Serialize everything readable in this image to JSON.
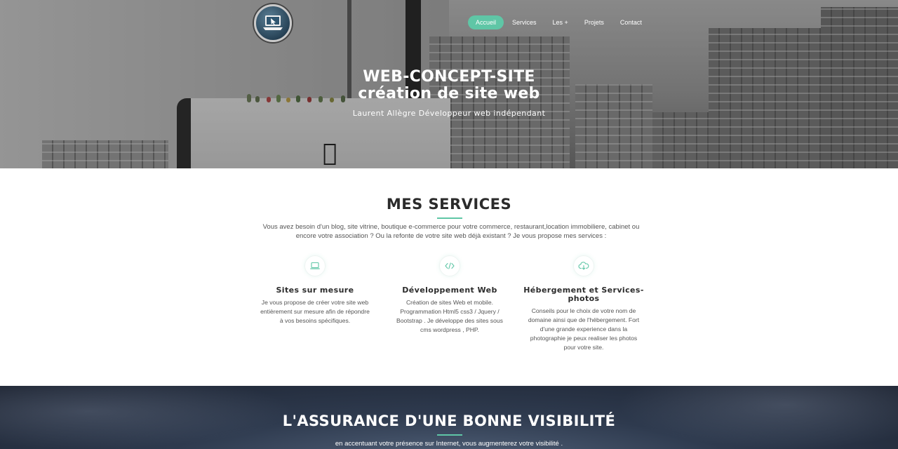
{
  "brand": {
    "logo_icon": "laptop-cursor-icon",
    "accent": "#5fc6a6"
  },
  "nav": {
    "items": [
      {
        "label": "Accueil",
        "active": true
      },
      {
        "label": "Services",
        "active": false
      },
      {
        "label": "Les +",
        "active": false
      },
      {
        "label": "Projets",
        "active": false
      },
      {
        "label": "Contact",
        "active": false
      }
    ]
  },
  "hero": {
    "title_line1": "WEB-CONCEPT-SITE",
    "title_line2": "création de site web",
    "subtitle": "Laurent Allègre Développeur web indépendant"
  },
  "services": {
    "title": "MES SERVICES",
    "intro": "Vous avez besoin d'un blog, site vitrine, boutique e-commerce pour votre commerce, restaurant,location immobiliere, cabinet ou encore votre association ? Ou la refonte de votre site web déjà existant ? Je vous propose mes services :",
    "items": [
      {
        "icon": "laptop-icon",
        "title": "Sites sur mesure",
        "text": "Je vous propose de créer votre site web entièrement sur mesure afin de répondre à vos besoins spécifiques."
      },
      {
        "icon": "code-icon",
        "title": "Développement Web",
        "text": "Création de sites Web et mobile. Programmation Html5 css3 / Jquery / Bootstrap . Je développe des sites sous cms wordpress , PHP."
      },
      {
        "icon": "cloud-download-icon",
        "title": "Hébergement et Services-photos",
        "text": "Conseils pour le choix de votre nom de domaine ainsi que de l'hébergement. Fort d'une grande experience dans la photographie je peux realiser les photos pour votre site."
      }
    ]
  },
  "visibility": {
    "title": "L'ASSURANCE D'UNE BONNE VISIBILITÉ",
    "text": "en accentuant votre présence sur Internet, vous augmenterez votre visibilité ."
  }
}
